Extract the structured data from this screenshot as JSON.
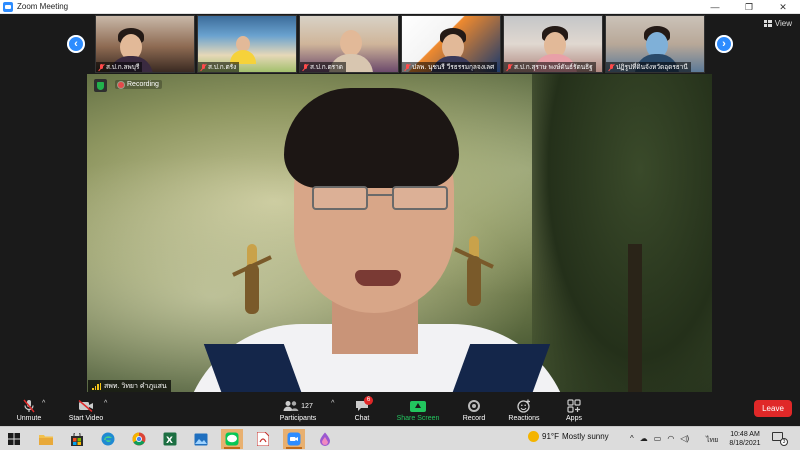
{
  "window": {
    "title": "Zoom Meeting",
    "controls": {
      "minimize": "—",
      "maximize": "❐",
      "close": "✕"
    }
  },
  "meeting": {
    "view_label": "View",
    "recording_label": "Recording",
    "speaker_name": "สพท. วิทยา คำภูแสน",
    "gallery": [
      {
        "name": "ส.ป.ก.ลพบุรี",
        "muted": true
      },
      {
        "name": "ส.ป.ก.ตรัง",
        "muted": true
      },
      {
        "name": "ส.ป.ก.ตราด",
        "muted": true
      },
      {
        "name": "ปลพ. นุชนรี วีรธรรมกุลจงเลศ",
        "muted": true
      },
      {
        "name": "ส.ป.ก.สุราษ พงษ์ดันธ์รัตนธิฐ",
        "muted": true
      },
      {
        "name": "ปฏิรูปที่ดินจังหวัดอุดรธานี",
        "muted": true
      }
    ]
  },
  "toolbar": {
    "unmute_label": "Unmute",
    "start_video_label": "Start Video",
    "participants_label": "Participants",
    "participants_count": "127",
    "chat_label": "Chat",
    "chat_badge": "6",
    "share_label": "Share Screen",
    "record_label": "Record",
    "reactions_label": "Reactions",
    "apps_label": "Apps",
    "leave_label": "Leave"
  },
  "taskbar": {
    "weather_temp": "91°F",
    "weather_text": "Mostly sunny",
    "language": "ไทย",
    "time": "10:48 AM",
    "date": "8/18/2021",
    "notification_count": "3",
    "apps": [
      "windows-start",
      "file-explorer",
      "store",
      "edge",
      "chrome",
      "excel",
      "photos",
      "line",
      "acrobat",
      "zoom",
      "paint"
    ]
  },
  "colors": {
    "zoom_blue": "#2d8cff",
    "leave_red": "#e02828",
    "share_green": "#22c55e",
    "recording_red": "#e34a4a"
  }
}
